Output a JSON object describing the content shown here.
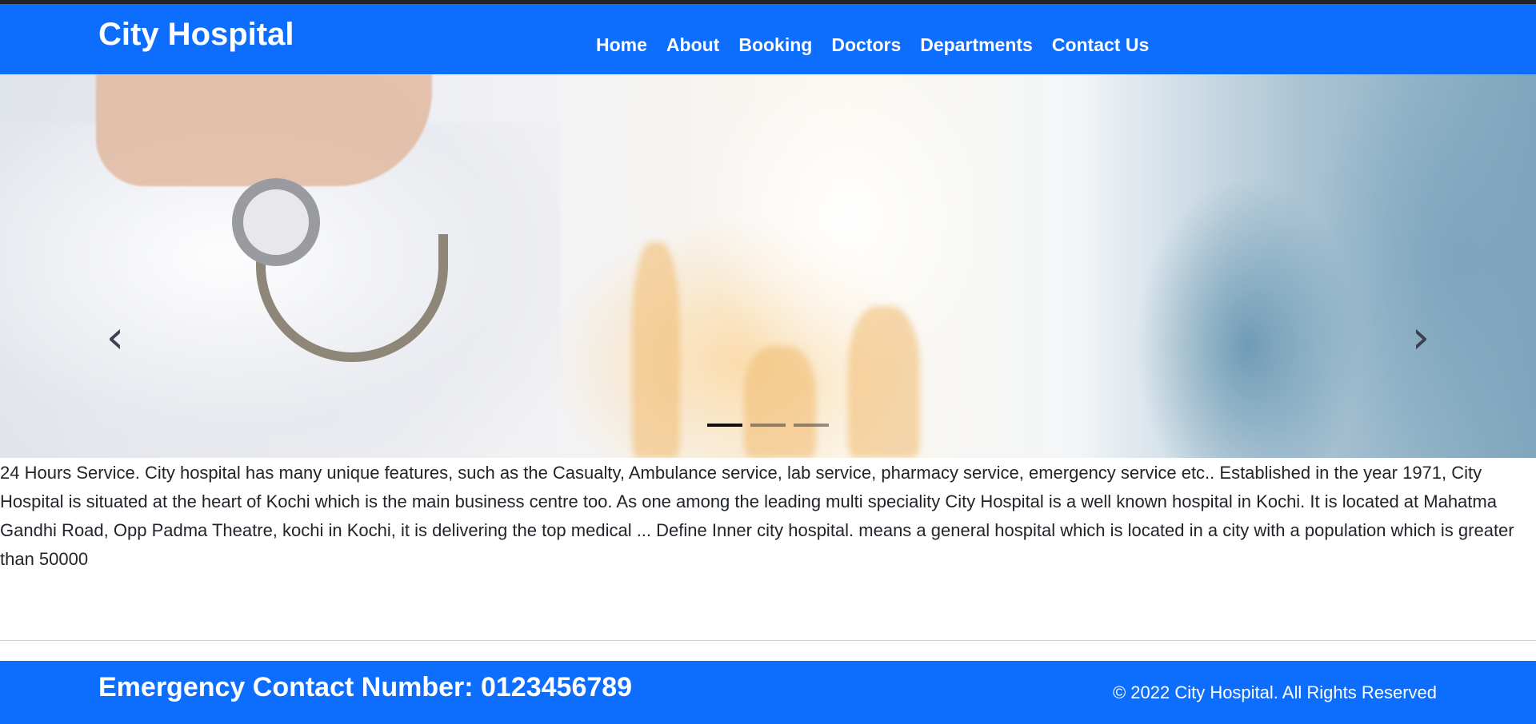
{
  "header": {
    "brand": "City Hospital",
    "nav": [
      {
        "label": "Home"
      },
      {
        "label": "About"
      },
      {
        "label": "Booking"
      },
      {
        "label": "Doctors"
      },
      {
        "label": "Departments"
      },
      {
        "label": "Contact Us"
      }
    ]
  },
  "carousel": {
    "prev_icon": "chevron-left-icon",
    "next_icon": "chevron-right-icon",
    "slide_count": 3,
    "active_slide": 1
  },
  "main": {
    "description": "24 Hours Service. City hospital has many unique features, such as the Casualty, Ambulance service, lab service, pharmacy service, emergency service etc.. Established in the year 1971, City Hospital is situated at the heart of Kochi which is the main business centre too. As one among the leading multi speciality City Hospital is a well known hospital in Kochi. It is located at Mahatma Gandhi Road, Opp Padma Theatre, kochi in Kochi, it is delivering the top medical ... Define Inner city hospital. means a general hospital which is located in a city with a population which is greater than 50000"
  },
  "footer": {
    "emergency": "Emergency Contact Number: 0123456789",
    "copyright": "© 2022 City Hospital. All Rights Reserved"
  },
  "colors": {
    "primary": "#0d6efd",
    "dark_strip": "#212529"
  }
}
